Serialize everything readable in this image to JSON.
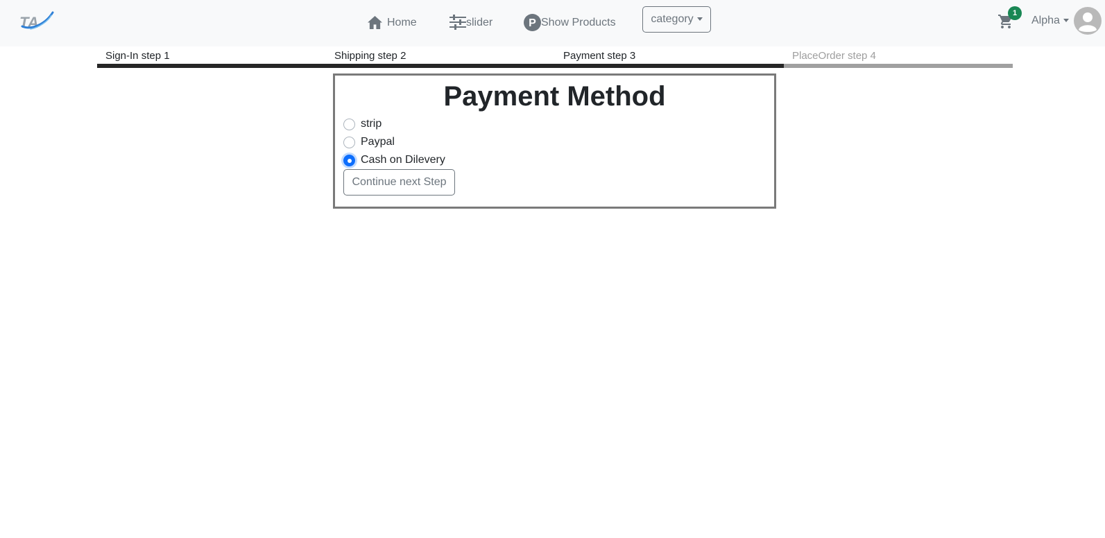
{
  "navbar": {
    "logo_icon": "ta-logo",
    "home": {
      "label": "Home",
      "icon": "home-icon"
    },
    "slider": {
      "label": "slider",
      "icon": "sliders-icon"
    },
    "products": {
      "label": "Show Products",
      "icon": "p-circle-icon"
    },
    "category": {
      "label": "category",
      "icon": "caret-down-icon"
    },
    "cart": {
      "icon": "cart-icon",
      "count": "1"
    },
    "user": {
      "label": "Alpha",
      "avatar_icon": "user-avatar-icon"
    }
  },
  "steps": [
    {
      "label": "Sign-In step 1",
      "active": true
    },
    {
      "label": "Shipping step 2",
      "active": true
    },
    {
      "label": "Payment step 3",
      "active": true
    },
    {
      "label": "PlaceOrder step 4",
      "active": false
    }
  ],
  "payment": {
    "title": "Payment Method",
    "options": [
      {
        "label": "strip",
        "checked": false
      },
      {
        "label": "Paypal",
        "checked": false
      },
      {
        "label": "Cash on Dilevery",
        "checked": true
      }
    ],
    "continue_label": "Continue next Step"
  },
  "colors": {
    "navbar_bg": "#f8f9fa",
    "accent": "#0d6efd",
    "badge": "#198754",
    "step_active": "#262626",
    "step_inactive": "#a0a0a0"
  }
}
